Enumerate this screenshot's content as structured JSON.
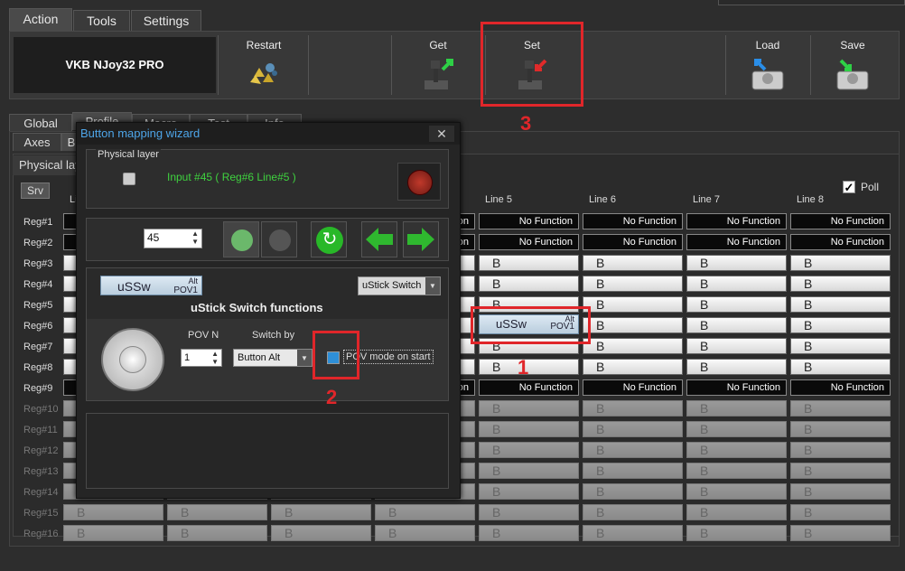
{
  "tabs": {
    "action": "Action",
    "tools": "Tools",
    "settings": "Settings"
  },
  "toolbar": {
    "device": "VKB NJoy32 PRO",
    "restart": "Restart",
    "get": "Get",
    "set": "Set",
    "load": "Load",
    "save": "Save"
  },
  "subtabs": {
    "global": "Global",
    "profile": "Profile",
    "macro": "Macro",
    "test": "Test",
    "info": "Info",
    "axes": "Axes",
    "b": "B"
  },
  "physical_layer_tab": "Physical lay",
  "srv": "Srv",
  "poll": "Poll",
  "line_headers": [
    "Li",
    "Line 5",
    "Line 6",
    "Line 7",
    "Line 8"
  ],
  "rows": [
    "Reg#1",
    "Reg#2",
    "Reg#3",
    "Reg#4",
    "Reg#5",
    "Reg#6",
    "Reg#7",
    "Reg#8",
    "Reg#9",
    "Reg#10",
    "Reg#11",
    "Reg#12",
    "Reg#13",
    "Reg#14",
    "Reg#15",
    "Reg#16"
  ],
  "cell_values": {
    "no_function": "No Function",
    "b": "B",
    "ussw": "uSSw",
    "alt": "Alt",
    "pov1": "POV1"
  },
  "dialog": {
    "title": "Button mapping wizard",
    "close": "✕",
    "physical_layer": "Physical layer",
    "input_info": "Input #45 ( Reg#6  Line#5 )",
    "button_number": "45",
    "function_cell": {
      "label": "uSSw",
      "alt": "Alt",
      "pov": "POV1"
    },
    "function_type": "uStick Switch",
    "functions_title": "uStick Switch functions",
    "pov_n_label": "POV N",
    "pov_n_value": "1",
    "switch_by_label": "Switch by",
    "switch_by_value": "Button Alt",
    "pov_mode_label": "POV mode on start"
  },
  "annotations": {
    "one": "1",
    "two": "2",
    "three": "3"
  },
  "colors": {
    "accent": "#4ea5e8",
    "annotation": "#e0262a",
    "input_text": "#3fd23f"
  }
}
